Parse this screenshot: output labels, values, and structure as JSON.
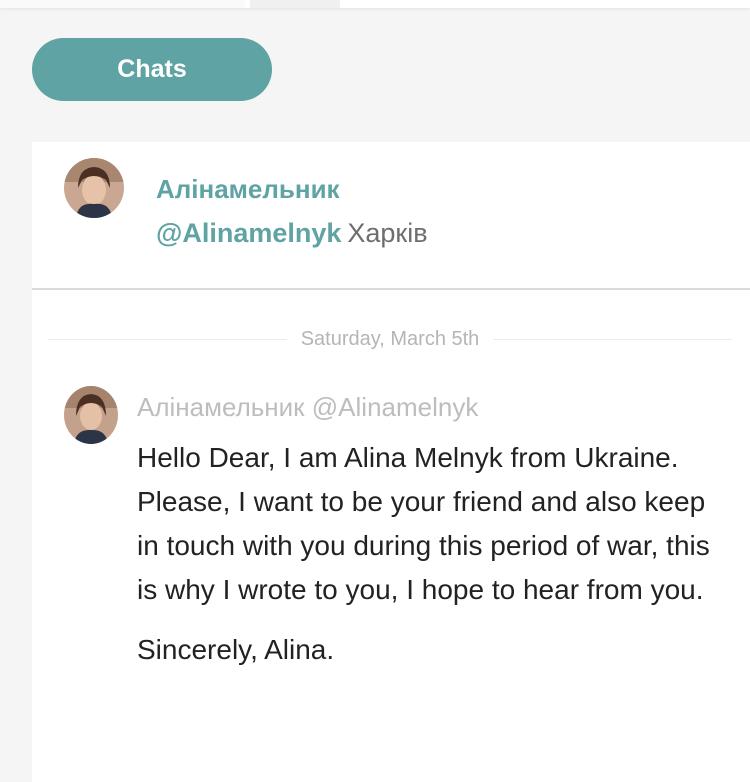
{
  "nav": {
    "chats_label": "Chats"
  },
  "contact": {
    "name": "Алінамельник",
    "handle": "@Alinamelnyk",
    "city": "Харків",
    "avatar_icon": "profile-photo"
  },
  "conversation": {
    "date_separator": "Saturday, March 5th",
    "messages": [
      {
        "author": "Алінамельник @Alinamelnyk",
        "avatar_icon": "profile-photo",
        "body": "Hello Dear, I am Alina Melnyk from Ukraine. Please, I want to be your friend and also keep in touch with you during this period of war, this is why I wrote to you, I hope to hear from you.",
        "signature": "Sincerely, Alina."
      }
    ]
  },
  "colors": {
    "accent": "#5fa3a4",
    "background": "#f5f5f5",
    "panel": "#ffffff",
    "muted_text": "#bdbdbd",
    "body_text": "#222222"
  }
}
